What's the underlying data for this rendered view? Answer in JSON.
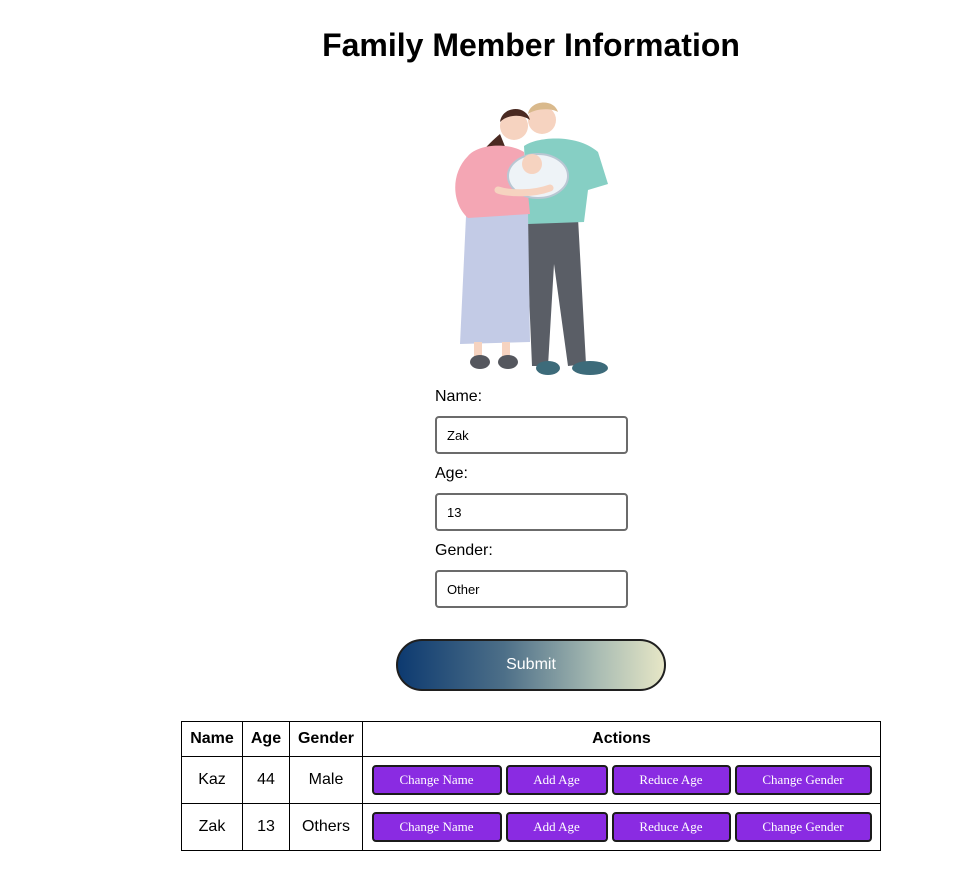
{
  "page": {
    "title": "Family Member Information"
  },
  "illustration": {
    "icon": "family-illustration",
    "description_colors": {
      "mother_top": "#f4a6b4",
      "mother_skirt": "#c3cbe6",
      "father_shirt": "#86cfc4",
      "father_pants": "#5a5e66",
      "hair": "#4a2a22",
      "father_hair": "#d9b98c",
      "skin": "#f6d3c0"
    }
  },
  "form": {
    "name_label": "Name:",
    "name_value": "Zak",
    "age_label": "Age:",
    "age_value": "13",
    "gender_label": "Gender:",
    "gender_value": "Other",
    "submit_label": "Submit"
  },
  "table": {
    "headers": [
      "Name",
      "Age",
      "Gender",
      "Actions"
    ],
    "rows": [
      {
        "name": "Kaz",
        "age": "44",
        "gender": "Male"
      },
      {
        "name": "Zak",
        "age": "13",
        "gender": "Others"
      }
    ],
    "actions": {
      "change_name": "Change Name",
      "add_age": "Add Age",
      "reduce_age": "Reduce Age",
      "change_gender": "Change Gender"
    }
  },
  "colors": {
    "action_button": "#8a2be2",
    "submit_gradient_start": "#0d3a70",
    "submit_gradient_end": "#e6e6c6"
  }
}
